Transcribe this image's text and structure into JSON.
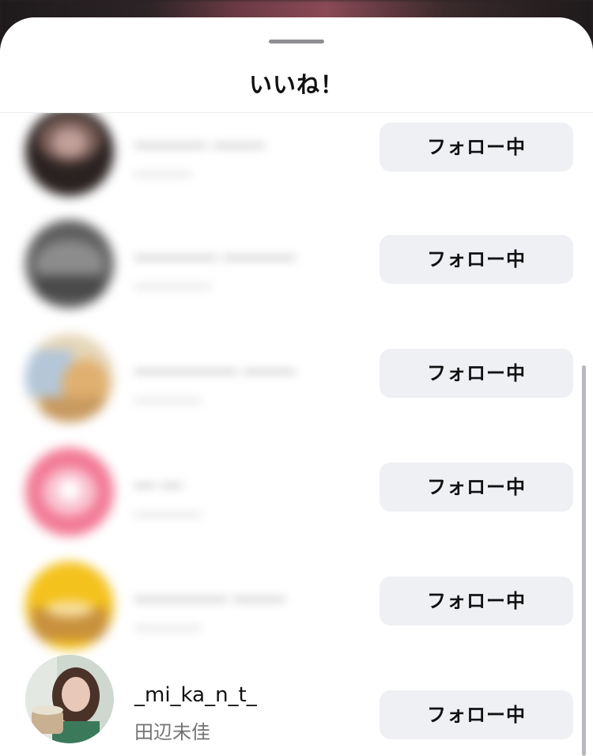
{
  "sheet": {
    "title": "いいね！"
  },
  "likes": [
    {
      "username": "_______ _____",
      "display_name": "______",
      "follow_label": "フォロー中",
      "avatar_colors": [
        "#3a2e2c",
        "#8a6a62"
      ]
    },
    {
      "username": "________ _______",
      "display_name": "________",
      "follow_label": "フォロー中",
      "avatar_colors": [
        "#6a6a6a",
        "#9c9c9c"
      ]
    },
    {
      "username": "__________ _____",
      "display_name": "_______",
      "follow_label": "フォロー中",
      "avatar_colors": [
        "#d8c8a8",
        "#a8c0d8"
      ]
    },
    {
      "username": "__ __",
      "display_name": "_______",
      "follow_label": "フォロー中",
      "avatar_colors": [
        "#f07090",
        "#f8c0d0"
      ]
    },
    {
      "username": "_________ _____",
      "display_name": "_______",
      "follow_label": "フォロー中",
      "avatar_colors": [
        "#f0c020",
        "#c89040"
      ]
    },
    {
      "username": "_mi_ka_n_t_",
      "display_name": "田辺未佳",
      "follow_label": "フォロー中",
      "avatar_colors": [
        "#6a5040",
        "#d8c0b0"
      ]
    }
  ]
}
